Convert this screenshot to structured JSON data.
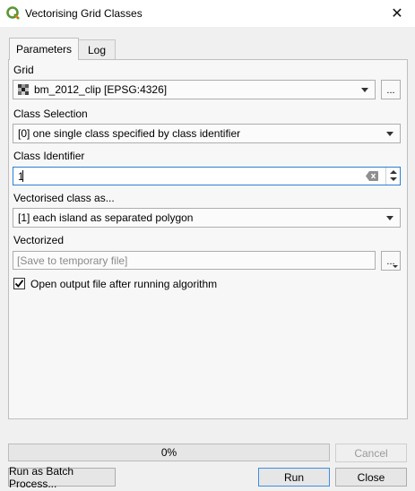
{
  "window": {
    "title": "Vectorising Grid Classes",
    "close_glyph": "✕"
  },
  "tabs": [
    {
      "label": "Parameters"
    },
    {
      "label": "Log"
    }
  ],
  "grid": {
    "label": "Grid",
    "value": "bm_2012_clip [EPSG:4326]",
    "browse": "..."
  },
  "class_selection": {
    "label": "Class Selection",
    "value": "[0] one single class specified by class identifier"
  },
  "class_identifier": {
    "label": "Class Identifier",
    "value": "1"
  },
  "vectorised_class": {
    "label": "Vectorised class as...",
    "value": "[1] each island as separated polygon"
  },
  "vectorized": {
    "label": "Vectorized",
    "placeholder": "[Save to temporary file]",
    "browse": "..."
  },
  "open_output": {
    "label": "Open output file after running algorithm",
    "checked": true
  },
  "progress": {
    "text": "0%",
    "value": 0
  },
  "buttons": {
    "cancel": "Cancel",
    "batch": "Run as Batch Process...",
    "run": "Run",
    "close": "Close"
  },
  "colors": {
    "accent": "#2a7fd3",
    "qgis_green": "#589632",
    "qgis_yellow": "#ee7913"
  }
}
